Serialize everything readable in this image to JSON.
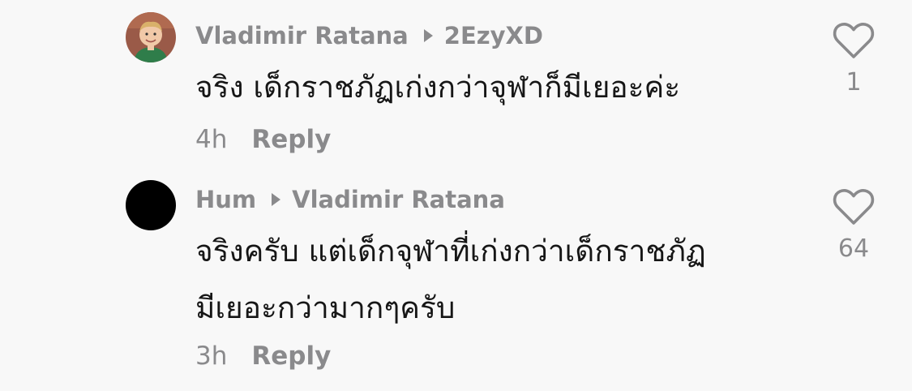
{
  "comments": [
    {
      "author": "Vladimir Ratana",
      "reply_to": "2EzyXD",
      "avatar": "photo-avatar-child",
      "text_lines": [
        "จริง เด็กราชภัฏเก่งกว่าจุฬาก็มีเยอะค่ะ"
      ],
      "time": "4h",
      "reply_label": "Reply",
      "likes": "1",
      "like_icon": "heart-outline-icon"
    },
    {
      "author": "Hum",
      "reply_to": "Vladimir Ratana",
      "avatar": "black-circle-avatar",
      "text_lines": [
        "จริงครับ แต่เด็กจุฬาที่เก่งกว่าเด็กราชภัฏ",
        "มีเยอะกว่ามากๆครับ"
      ],
      "time": "3h",
      "reply_label": "Reply",
      "likes": "64",
      "like_icon": "heart-outline-icon"
    }
  ],
  "colors": {
    "background": "#f8f8f8",
    "secondary_text": "#8a8a8c",
    "primary_text": "#161616"
  }
}
